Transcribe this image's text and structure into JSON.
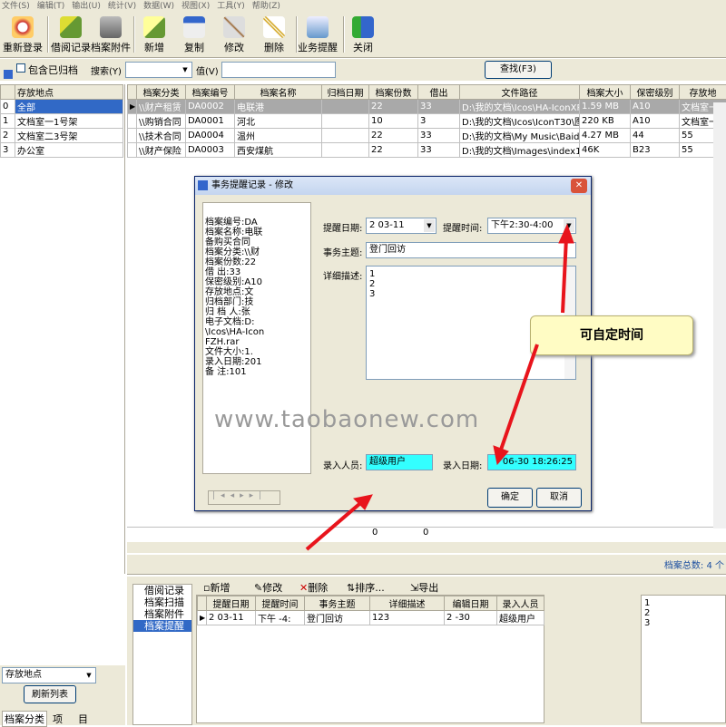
{
  "menu": [
    "文件(S)",
    "编辑(T)",
    "输出(U)",
    "统计(V)",
    "数据(W)",
    "视图(X)",
    "工具(Y)",
    "帮助(Z)"
  ],
  "toolbar": {
    "relogin": "重新登录",
    "borrow": "借阅记录",
    "attach": "档案附件",
    "add": "新增",
    "copy": "复制",
    "edit": "修改",
    "delete": "删除",
    "remind": "业务提醒",
    "close": "关闭"
  },
  "filter": {
    "include_archived": "包含已归档",
    "search_label": "搜索(Y)",
    "value_label": "值(V)",
    "find_button": "查找(F3)"
  },
  "locations": {
    "headers": [
      "",
      "存放地点"
    ],
    "rows": [
      [
        "0",
        "全部"
      ],
      [
        "1",
        "文档室一1号架"
      ],
      [
        "2",
        "文档室二3号架"
      ],
      [
        "3",
        "办公室"
      ]
    ]
  },
  "archives": {
    "headers": [
      "档案分类",
      "档案编号",
      "档案名称",
      "归档日期",
      "档案份数",
      "借出",
      "文件路径",
      "档案大小",
      "保密级别",
      "存放地"
    ],
    "rows": [
      [
        "\\\\财产租赁",
        "DA0002",
        "电联港",
        "",
        "22",
        "33",
        "D:\\我的文档\\Icos\\HA-IconXP_",
        "1.59 MB",
        "A10",
        "文档室一"
      ],
      [
        "\\\\购销合同",
        "DA0001",
        "河北",
        "",
        "10",
        "3",
        "D:\\我的文档\\Icos\\IconT30\\图",
        "220 KB",
        "A10",
        "文档室一"
      ],
      [
        "\\\\技术合同",
        "DA0004",
        "温州",
        "",
        "22",
        "33",
        "D:\\我的文档\\My Music\\Baidu",
        "4.27 MB",
        "44",
        "55"
      ],
      [
        "\\\\财产保险",
        "DA0003",
        "西安煤航",
        "",
        "22",
        "33",
        "D:\\我的文档\\Images\\index1_z",
        "46K",
        "B23",
        "55"
      ]
    ],
    "totals": [
      "0",
      "0"
    ],
    "count_label": "档案总数: 4 个"
  },
  "dialog": {
    "title": "事务提醒记录 - 修改",
    "info_lines": [
      "档案编号:DA",
      "档案名称:电联",
      "备购买合同",
      "档案分类:\\\\财",
      "档案份数:22",
      "借   出:33",
      "保密级别:A10",
      "存放地点:文",
      "归档部门:技",
      "归 档 人:张",
      "电子文档:D:",
      "\\Icos\\HA-Icon",
      "FZH.rar",
      "文件大小:1.",
      "录入日期:201",
      "备   注:101"
    ],
    "remind_date_label": "提醒日期:",
    "remind_date": "2   03-11",
    "remind_time_label": "提醒时间:",
    "remind_time": "下午2:30-4:00",
    "subject_label": "事务主题:",
    "subject": "登门回访",
    "detail_label": "详细描述:",
    "detail_lines": [
      "1",
      "2",
      "3"
    ],
    "entry_user_label": "录入人员:",
    "entry_user": "超级用户",
    "entry_date_label": "录入日期:",
    "entry_date": "06-30 18:26:25",
    "ok": "确定",
    "cancel": "取消"
  },
  "callout_text": "可自定时间",
  "watermark": "www.taobaonew.com",
  "bottom": {
    "toolbar": [
      "新增",
      "修改",
      "删除",
      "排序...",
      "导出"
    ],
    "side_tabs": [
      "借阅记录",
      "档案扫描",
      "档案附件",
      "档案提醒"
    ],
    "headers": [
      "",
      "提醒日期",
      "提醒时间",
      "事务主题",
      "详细描述",
      "编辑日期",
      "录入人员"
    ],
    "row": [
      "",
      "2   03-11",
      "下午   -4:",
      "登门回访",
      "123",
      "2    -30",
      "超级用户"
    ],
    "detail_lines": [
      "1",
      "2",
      "3"
    ]
  },
  "left_footer": {
    "select": "存放地点",
    "refresh": "刷新列表",
    "tabs": [
      "档案分类",
      "项",
      "目"
    ]
  },
  "colors": {
    "selection": "#3169c6",
    "cyan_field": "#33ffff",
    "annotation_red": "#e8141c"
  }
}
